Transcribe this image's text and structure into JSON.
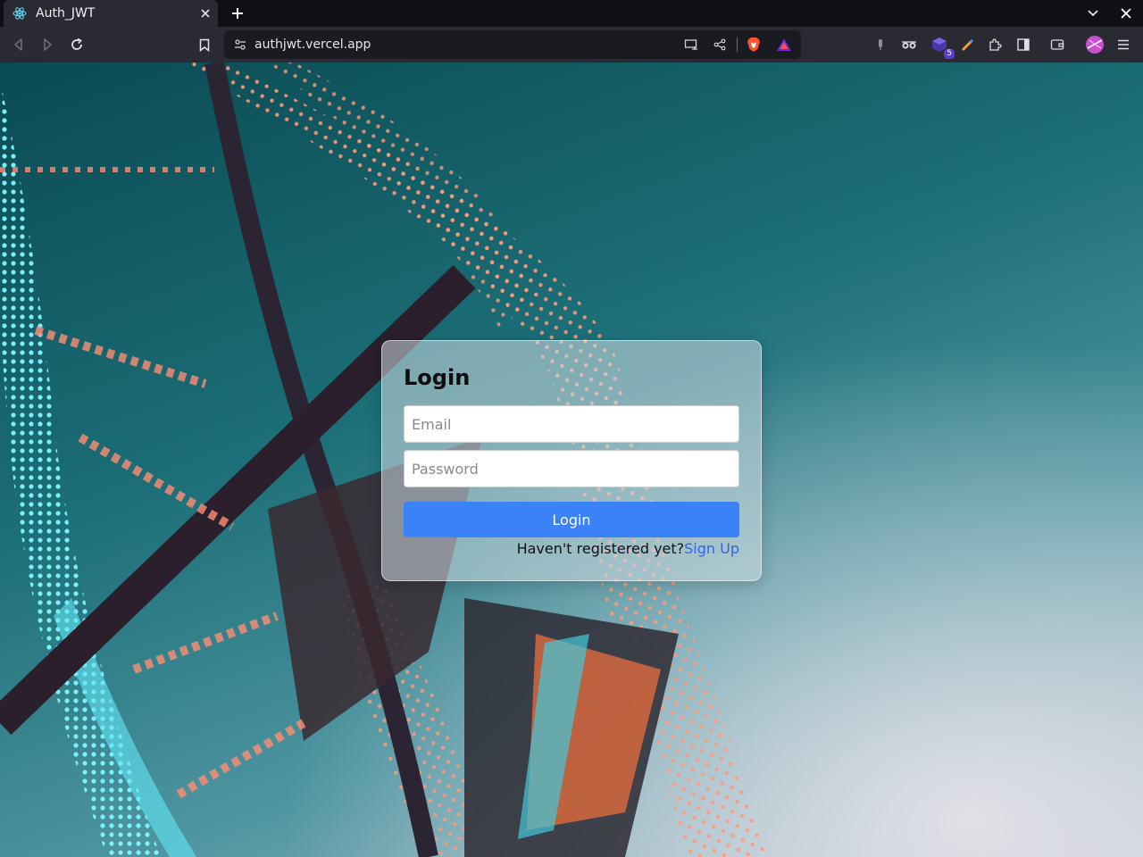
{
  "browser": {
    "tab": {
      "title": "Auth_JWT"
    },
    "address_bar": {
      "url": "authjwt.vercel.app"
    },
    "extensions": {
      "badge_count": "5"
    }
  },
  "page": {
    "login_card": {
      "title": "Login",
      "email_placeholder": "Email",
      "password_placeholder": "Password",
      "login_button": "Login",
      "register_prompt": "Haven't registered yet?",
      "signup_link": "Sign Up"
    }
  },
  "colors": {
    "primary_button": "#3b82f6",
    "link": "#2f66e0",
    "toolbar": "#2a2a33",
    "tabstrip": "#0f0f16"
  }
}
